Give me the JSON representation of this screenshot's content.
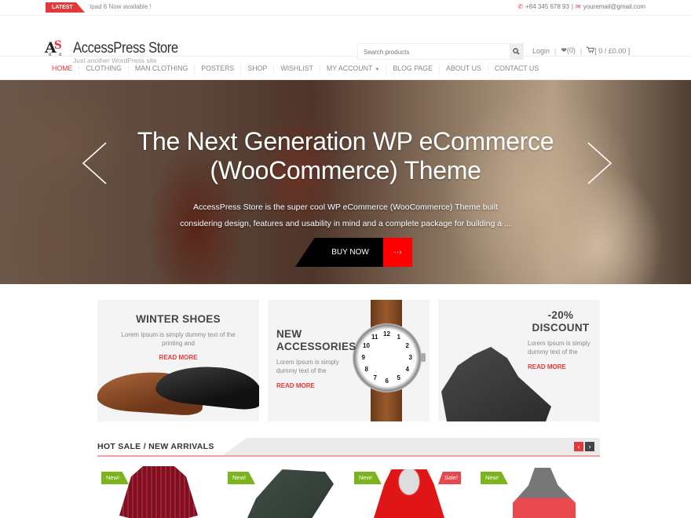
{
  "topbar": {
    "latest_label": "LATEST",
    "ticker_text": "Ipad 6 Now available !",
    "phone": "+84 345 678 93",
    "email": "youremail@gmail.com",
    "separator": "|"
  },
  "header": {
    "logo_letters": "AS",
    "site_title": "AccessPress Store",
    "tagline": "Just another WordPress site",
    "search": {
      "placeholder": "Search products"
    },
    "login_label": "Login",
    "wishlist_count": "(0)",
    "cart_summary": "[ 0 / £0.00 ]",
    "separator": "|"
  },
  "nav": {
    "items": [
      {
        "label": "HOME",
        "active": true
      },
      {
        "label": "CLOTHING"
      },
      {
        "label": "MAN CLOTHING"
      },
      {
        "label": "POSTERS"
      },
      {
        "label": "SHOP"
      },
      {
        "label": "WISHLIST"
      },
      {
        "label": "MY ACCOUNT",
        "has_dropdown": true
      },
      {
        "label": "BLOG PAGE"
      },
      {
        "label": "ABOUT US"
      },
      {
        "label": "CONTACT US"
      }
    ]
  },
  "hero": {
    "title_line1": "The Next Generation WP eCommerce",
    "title_line2": "(WooCommerce) Theme",
    "desc_line1": "AccessPress Store is the super cool WP eCommerce (WooCommerce) Theme  built",
    "desc_line2": "considering design, features and usability in mind and a complete package for building a ...",
    "cta_label": "BUY NOW",
    "cta_arrow": "··›"
  },
  "promos": [
    {
      "title": "WINTER SHOES",
      "text": "Lorem Ipsum is simply dummy text of the printing and",
      "link": "READ MORE"
    },
    {
      "title_line1": "NEW",
      "title_line2": "ACCESSORIES",
      "text": "Lorem Ipsum is simply dummy text of the",
      "link": "READ MORE"
    },
    {
      "title_line1": "-20%",
      "title_line2": "DISCOUNT",
      "text": "Lorem Ipsum is simply dummy text of the",
      "link": "READ MORE"
    }
  ],
  "watch_numbers": [
    "12",
    "1",
    "2",
    "3",
    "4",
    "5",
    "6",
    "7",
    "8",
    "9",
    "10",
    "11"
  ],
  "section": {
    "title": "HOT SALE / NEW ARRIVALS",
    "prev_icon": "‹",
    "next_icon": "›"
  },
  "products": [
    {
      "badges": [
        "New!"
      ],
      "name": "striped-blazer"
    },
    {
      "badges": [
        "New!"
      ],
      "name": "denim-jeans"
    },
    {
      "badges": [
        "New!",
        "Sale!"
      ],
      "name": "red-hoodie"
    },
    {
      "badges": [
        "New!"
      ],
      "name": "grey-hoodie"
    }
  ],
  "colors": {
    "accent": "#e5383b",
    "new_badge": "#7ab51d",
    "cta_black": "#000000",
    "cta_red": "#ff0000"
  }
}
